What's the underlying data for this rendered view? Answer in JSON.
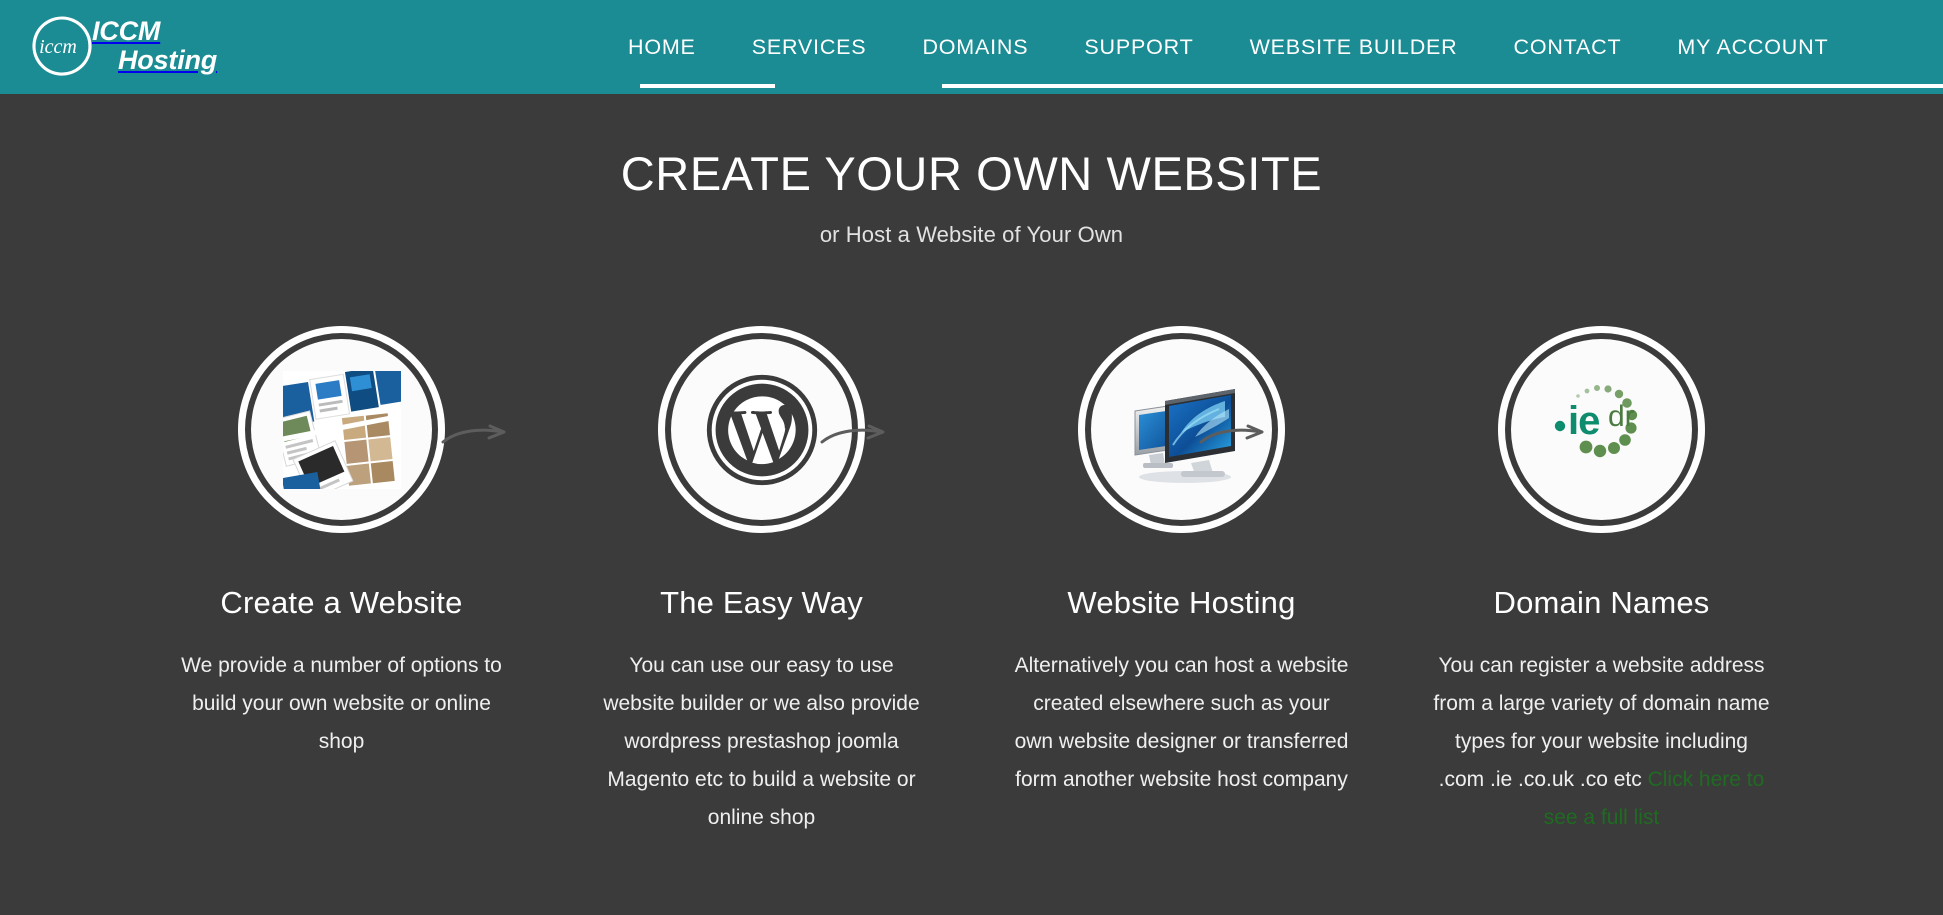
{
  "brand": {
    "mark_text": "iccm",
    "line1": "ICCM",
    "line2": "Hosting"
  },
  "nav": {
    "items": [
      {
        "label": "HOME",
        "name": "nav-item-home"
      },
      {
        "label": "SERVICES",
        "name": "nav-item-services"
      },
      {
        "label": "DOMAINS",
        "name": "nav-item-domains"
      },
      {
        "label": "SUPPORT",
        "name": "nav-item-support"
      },
      {
        "label": "WEBSITE BUILDER",
        "name": "nav-item-website-builder"
      },
      {
        "label": "CONTACT",
        "name": "nav-item-contact"
      },
      {
        "label": "MY ACCOUNT",
        "name": "nav-item-my-account"
      }
    ]
  },
  "hero": {
    "title": "CREATE YOUR OWN WEBSITE",
    "subtitle": "or Host a Website of Your Own"
  },
  "features": [
    {
      "icon": "website-templates-collage-icon",
      "title": "Create a Website",
      "description": "We provide a number of options to build your own website or online shop"
    },
    {
      "icon": "wordpress-logo-icon",
      "title": "The Easy Way",
      "description": "You can use our easy to use website builder or we also provide wordpress prestashop joomla Magento etc to build a website or online shop"
    },
    {
      "icon": "dual-monitors-icon",
      "title": "Website Hosting",
      "description": "Alternatively you can host a website created elsewhere such as your own website designer or transferred form another website host company"
    },
    {
      "icon": "iedr-logo-icon",
      "title": "Domain Names",
      "description": "You can register a website address from a large variety of domain name types for your website including .com .ie .co.uk .co etc ",
      "link_text": "Click here to see a full list"
    }
  ],
  "iedr_logo": {
    "dot_text": ".ie",
    "suffix_text": "dr"
  },
  "colors": {
    "brand_teal": "#1b8c93",
    "page_dark": "#3b3b3b",
    "link_green": "#1f6b21",
    "text_white": "#ffffff"
  }
}
